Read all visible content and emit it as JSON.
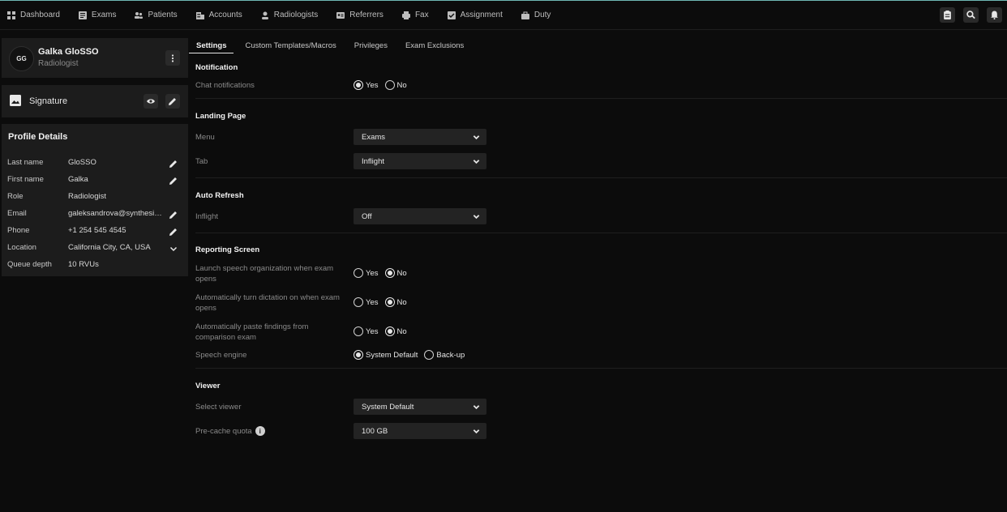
{
  "nav": {
    "items": [
      {
        "label": "Dashboard",
        "icon": "dashboard-icon"
      },
      {
        "label": "Exams",
        "icon": "exams-icon"
      },
      {
        "label": "Patients",
        "icon": "patients-icon"
      },
      {
        "label": "Accounts",
        "icon": "accounts-icon"
      },
      {
        "label": "Radiologists",
        "icon": "radiologists-icon"
      },
      {
        "label": "Referrers",
        "icon": "referrers-icon"
      },
      {
        "label": "Fax",
        "icon": "fax-icon"
      },
      {
        "label": "Assignment",
        "icon": "assignment-icon"
      },
      {
        "label": "Duty",
        "icon": "duty-icon"
      }
    ]
  },
  "profile": {
    "initials": "GG",
    "name": "Galka GloSSO",
    "role": "Radiologist"
  },
  "signature": {
    "label": "Signature"
  },
  "profile_details": {
    "title": "Profile Details",
    "rows": [
      {
        "label": "Last name",
        "value": "GloSSO",
        "action": "pencil"
      },
      {
        "label": "First name",
        "value": "Galka",
        "action": "pencil"
      },
      {
        "label": "Role",
        "value": "Radiologist",
        "action": "none"
      },
      {
        "label": "Email",
        "value": "galeksandrova@synthesis.com",
        "action": "pencil"
      },
      {
        "label": "Phone",
        "value": "+1 254 545 4545",
        "action": "pencil"
      },
      {
        "label": "Location",
        "value": "California City, CA, USA",
        "action": "chevron"
      },
      {
        "label": "Queue depth",
        "value": "10 RVUs",
        "action": "none"
      }
    ]
  },
  "tabs": [
    "Settings",
    "Custom Templates/Macros",
    "Privileges",
    "Exam Exclusions"
  ],
  "settings": {
    "notification": {
      "title": "Notification",
      "chat_label": "Chat notifications",
      "yes": "Yes",
      "no": "No",
      "selected": "Yes"
    },
    "landing": {
      "title": "Landing Page",
      "menu_label": "Menu",
      "menu_value": "Exams",
      "tab_label": "Tab",
      "tab_value": "Inflight"
    },
    "auto_refresh": {
      "title": "Auto Refresh",
      "inflight_label": "Inflight",
      "inflight_value": "Off"
    },
    "reporting": {
      "title": "Reporting Screen",
      "items": [
        {
          "label": "Launch speech organization when exam opens",
          "selected": "No"
        },
        {
          "label": "Automatically turn dictation on when exam opens",
          "selected": "No"
        },
        {
          "label": "Automatically paste findings from comparison exam",
          "selected": "No"
        }
      ],
      "yes": "Yes",
      "no": "No",
      "speech_label": "Speech engine",
      "speech_opt1": "System Default",
      "speech_opt2": "Back-up",
      "speech_selected": "System Default"
    },
    "viewer": {
      "title": "Viewer",
      "select_label": "Select viewer",
      "select_value": "System Default",
      "precache_label": "Pre-cache quota",
      "precache_value": "100 GB"
    }
  }
}
